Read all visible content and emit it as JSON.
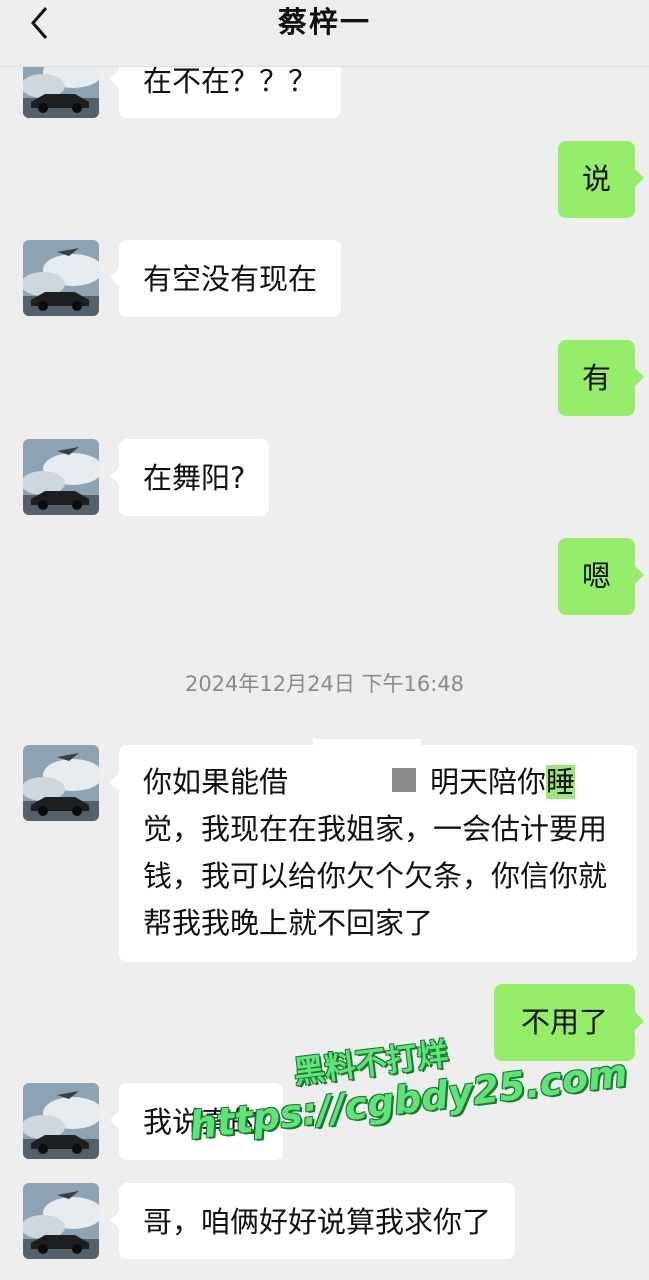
{
  "header": {
    "title": "蔡梓一"
  },
  "messages": [
    {
      "from": "contact",
      "text": "在不在？？？"
    },
    {
      "from": "me",
      "text": "说"
    },
    {
      "from": "contact",
      "text": "有空没有现在"
    },
    {
      "from": "me",
      "text": "有"
    },
    {
      "from": "contact",
      "text": "在舞阳?"
    },
    {
      "from": "me",
      "text": "嗯"
    },
    {
      "from": "contact",
      "text_part1": "你如果能借",
      "text_part2": "明天陪你",
      "text_highlight": "睡",
      "text_part3": "觉，我现在在我姐家，一会估计要用钱，我可以给你欠个欠条，你信你就帮我我晚上就不回家了"
    },
    {
      "from": "me",
      "text": "不用了"
    },
    {
      "from": "contact",
      "text": "我说真的"
    },
    {
      "from": "contact",
      "text": "哥，咱俩好好说算我求你了"
    }
  ],
  "timestamp": "2024年12月24日 下午16:48",
  "watermark": {
    "line1": "黑料不打烊",
    "line2": "https://cgbdy25.com"
  },
  "colors": {
    "background": "#ededed",
    "incoming_bubble": "#ffffff",
    "outgoing_bubble": "#95ec69"
  }
}
